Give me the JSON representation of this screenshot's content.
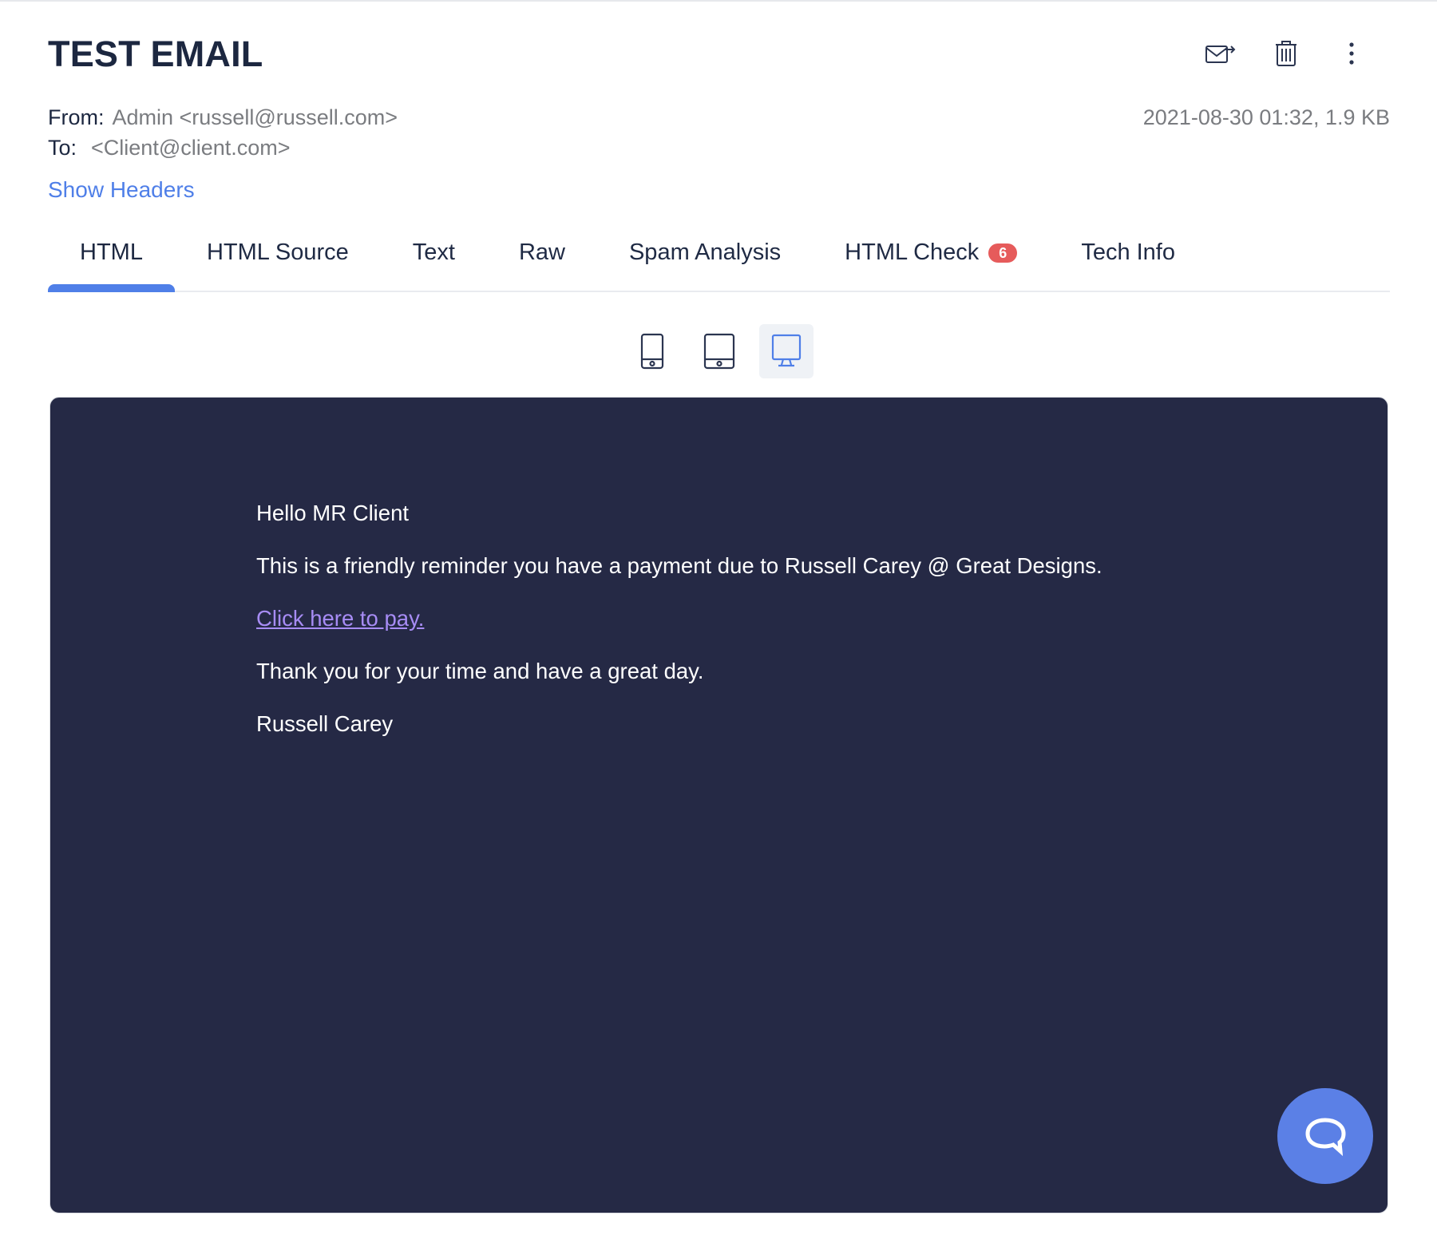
{
  "email": {
    "subject": "TEST EMAIL",
    "from_label": "From:",
    "from_value": "Admin <russell@russell.com>",
    "to_label": "To:",
    "to_value": "<Client@client.com>",
    "date_size": "2021-08-30 01:32, 1.9 KB",
    "show_headers": "Show Headers"
  },
  "toolbar": {
    "icons": [
      "forward-email-icon",
      "trash-icon",
      "more-vertical-icon"
    ]
  },
  "tabs": [
    {
      "label": "HTML",
      "active": true
    },
    {
      "label": "HTML Source"
    },
    {
      "label": "Text"
    },
    {
      "label": "Raw"
    },
    {
      "label": "Spam Analysis"
    },
    {
      "label": "HTML Check",
      "badge": "6"
    },
    {
      "label": "Tech Info"
    }
  ],
  "devices": {
    "icons": [
      "mobile-icon",
      "tablet-icon",
      "desktop-icon"
    ],
    "active": "desktop"
  },
  "preview": {
    "greeting": "Hello MR Client",
    "line1": "This is a friendly reminder you have a payment due to Russell Carey @ Great Designs.",
    "pay_link": "Click here to pay.",
    "thanks": "Thank you for your time and have a great day.",
    "signature": "Russell Carey"
  },
  "colors": {
    "accent": "#4f7fe8",
    "preview_bg": "#252945",
    "badge": "#e65b5b",
    "link": "#a78cf5"
  }
}
